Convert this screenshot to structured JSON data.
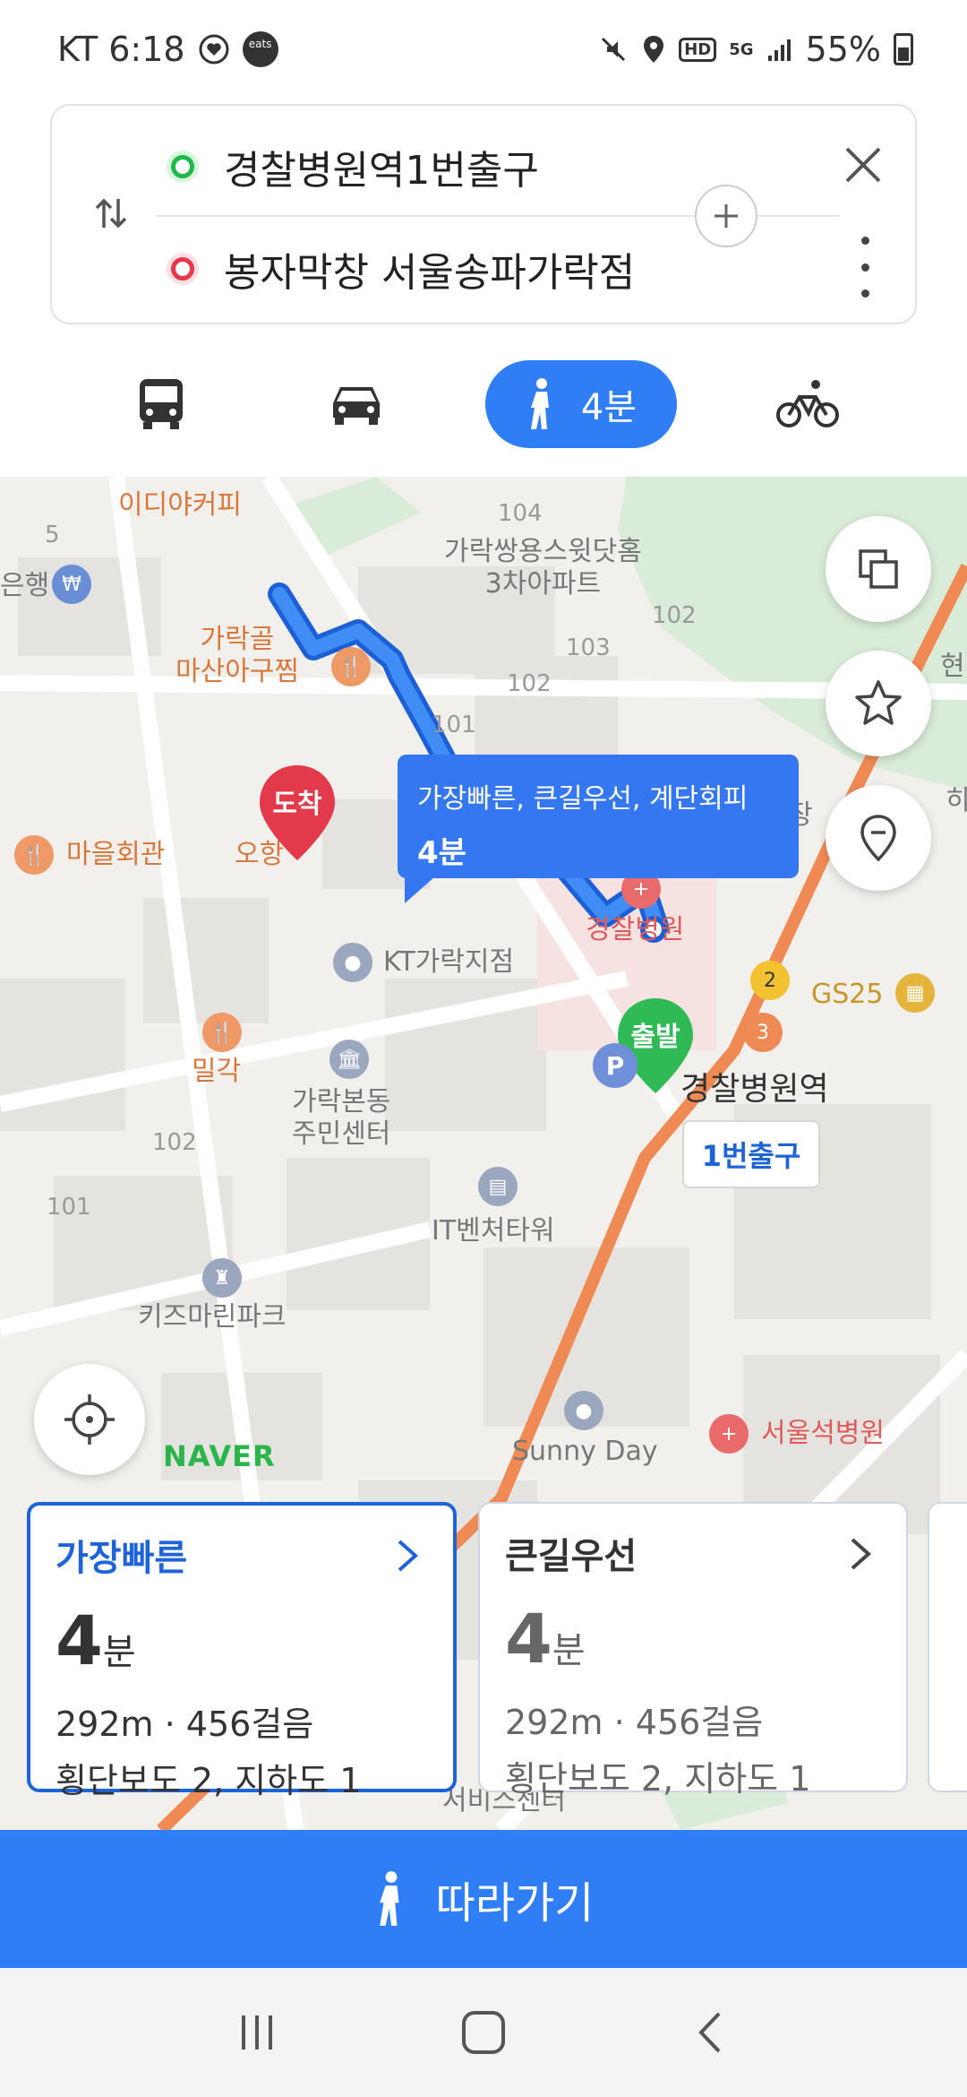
{
  "status_bar": {
    "carrier_time": "KT 6:18",
    "eats_badge": "coupang eats",
    "network": "5G",
    "hd": "HD",
    "battery": "55%"
  },
  "route": {
    "start": "경찰병원역1번출구",
    "destination": "봉자막창 서울송파가락점"
  },
  "modes": {
    "walk_time": "4분",
    "selected": "walk"
  },
  "map": {
    "labels": {
      "idiya": "이디야커피",
      "bank": "은행",
      "garak_masan": "가락골\n마산아구찜",
      "maeul": "마을회관",
      "ohyang": "오항",
      "apt": "가락쌍용스윗닷홈\n3차아파트",
      "kt_branch": "KT가락지점",
      "hospital": "경찰병원",
      "station": "경찰병원역",
      "gs25": "GS25",
      "milgak": "밀각",
      "center": "가락본동\n주민센터",
      "it_tower": "IT벤처타워",
      "kids": "키즈마린파크",
      "sunny": "Sunny Day",
      "seoul_hosp": "서울석병원",
      "service": "서비스센터",
      "n104": "104",
      "n103": "103",
      "n102a": "102",
      "n102b": "102",
      "n101a": "101",
      "n102c": "102",
      "n101b": "101",
      "n5": "5",
      "jang": "장",
      "hyun": "현",
      "hi": "히"
    },
    "tooltip_route": "가장빠른, 큰길우선, 계단회피",
    "tooltip_time": "4분",
    "arrival_pin": "도착",
    "departure_pin": "출발",
    "exit_badge": "1번출구",
    "logo": "NAVER"
  },
  "options": [
    {
      "title": "가장빠른",
      "time_num": "4",
      "time_unit": "분",
      "distance": "292m",
      "steps": "456걸음",
      "detail": "횡단보도 2, 지하도 1"
    },
    {
      "title": "큰길우선",
      "time_num": "4",
      "time_unit": "분",
      "distance": "292m",
      "steps": "456걸음",
      "detail": "횡단보도 2, 지하도 1"
    }
  ],
  "follow_button": "따라가기",
  "colors": {
    "accent": "#2f7ef5",
    "route": "#3477f0",
    "start_green": "#1fb84c",
    "end_red": "#e6384a"
  }
}
